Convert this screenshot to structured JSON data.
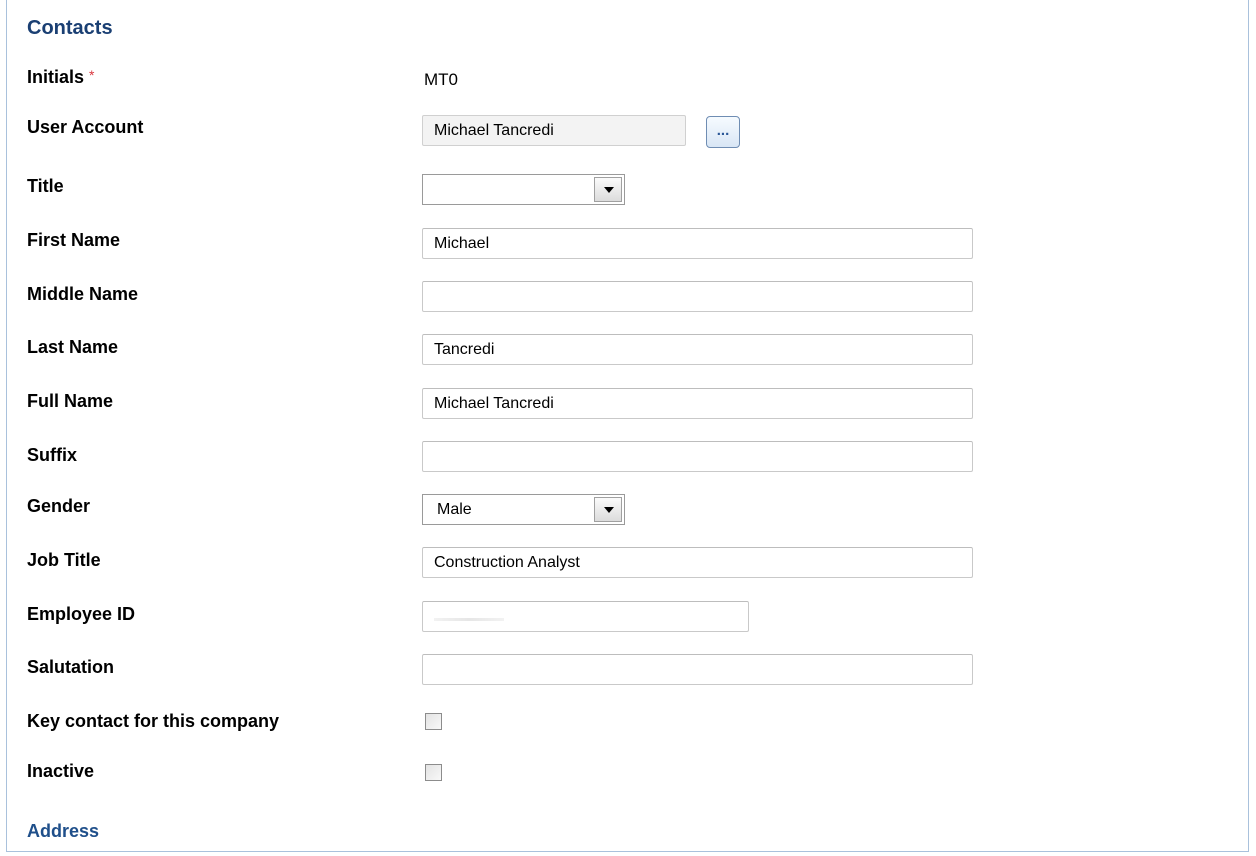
{
  "sections": {
    "contacts_title": "Contacts",
    "address_title": "Address"
  },
  "fields": {
    "initials": {
      "label": "Initials",
      "required_mark": "*",
      "value": "MT0"
    },
    "user_account": {
      "label": "User Account",
      "value": "Michael Tancredi",
      "lookup_label": "..."
    },
    "title": {
      "label": "Title",
      "value": ""
    },
    "first_name": {
      "label": "First Name",
      "value": "Michael"
    },
    "middle_name": {
      "label": "Middle Name",
      "value": ""
    },
    "last_name": {
      "label": "Last Name",
      "value": "Tancredi"
    },
    "full_name": {
      "label": "Full Name",
      "value": "Michael Tancredi"
    },
    "suffix": {
      "label": "Suffix",
      "value": ""
    },
    "gender": {
      "label": "Gender",
      "value": "Male"
    },
    "job_title": {
      "label": "Job Title",
      "value": "Construction Analyst"
    },
    "employee_id": {
      "label": "Employee ID",
      "value": ""
    },
    "salutation": {
      "label": "Salutation",
      "value": ""
    },
    "key_contact": {
      "label": "Key contact for this company",
      "checked": false
    },
    "inactive": {
      "label": "Inactive",
      "checked": false
    }
  },
  "icons": {
    "dropdown": "chevron-down-icon",
    "lookup": "ellipsis-icon"
  },
  "colors": {
    "section_title": "#1a3f73",
    "required": "#d9363e",
    "frame_border": "#a9c1dc"
  }
}
